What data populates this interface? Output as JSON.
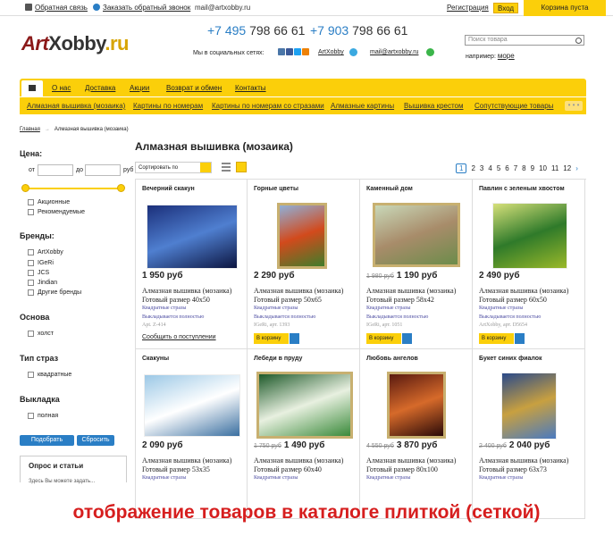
{
  "topbar": {
    "feedback": "Обратная связь",
    "callback": "Заказать обратный звонок",
    "email": "mail@artxobby.ru",
    "register": "Регистрация",
    "login": "Вход",
    "cart": "Корзина пуста"
  },
  "header": {
    "logo_art": "Art",
    "logo_xobby": "Xobby",
    "logo_ru": ".ru",
    "phone1_code": "+7 495",
    "phone1_num": "798 66 61",
    "phone2_code": "+7 903",
    "phone2_num": "798 66 61",
    "social_label": "Мы в социальных сетях:",
    "skype": "ArtXobby",
    "mail": "mail@artxobby.ru",
    "search_placeholder": "Поиск товара",
    "example_label": "например:",
    "example_value": "море"
  },
  "nav_main": [
    "О нас",
    "Доставка",
    "Акции",
    "Возврат и обмен",
    "Контакты"
  ],
  "nav_cat": [
    "Алмазная вышивка (мозаика)",
    "Картины по номерам",
    "Картины по номерам со стразами",
    "Алмазные картины",
    "Вышивка крестом",
    "Сопутствующие товары"
  ],
  "nav_more": "• • •",
  "breadcrumb": {
    "home": "Главная",
    "arrow": "→",
    "current": "Алмазная вышивка (мозаика)"
  },
  "page_title": "Алмазная вышивка (мозаика)",
  "sidebar": {
    "price": "Цена:",
    "from": "от",
    "to": "до",
    "currency": "руб",
    "price_opts": [
      "Акционные",
      "Рекомендуемые"
    ],
    "brands": "Бренды:",
    "brand_opts": [
      "ArtXobby",
      "IGeRi",
      "JCS",
      "Jindian",
      "Другие бренды"
    ],
    "base": "Основа",
    "base_opts": [
      "холст"
    ],
    "stones": "Тип страз",
    "stones_opts": [
      "квадратные"
    ],
    "layout": "Выкладка",
    "layout_opts": [
      "полная"
    ],
    "btn_select": "Подобрать",
    "btn_reset": "Сбросить",
    "box_title": "Опрос и статьи",
    "box_sub": "Здесь Вы можете задать..."
  },
  "toolbar": {
    "sort": "Сортировать по"
  },
  "pager": [
    "1",
    "2",
    "3",
    "4",
    "5",
    "6",
    "7",
    "8",
    "9",
    "10",
    "11",
    "12"
  ],
  "products": [
    {
      "name": "Вечерний скакун",
      "old": "",
      "price": "1 950 руб",
      "cat": "Алмазная вышивка (мозаика)",
      "size": "Готовый размер 40х50",
      "f1": "Квадратные стразы",
      "f2": "Выкладывается полностью",
      "art": "Apt. Z-414",
      "action": "Сообщить о поступлении",
      "cart": "В корзину",
      "colors": [
        "#1b2f7a",
        "#4f7fd0",
        "#0c1540"
      ]
    },
    {
      "name": "Горные цветы",
      "old": "",
      "price": "2 290 руб",
      "cat": "Алмазная вышивка (мозаика)",
      "size": "Готовый размер 50х65",
      "f1": "Квадратные стразы",
      "f2": "Выкладывается полностью",
      "art": "IGeRi, арт. 1393",
      "action": "",
      "cart": "В корзину",
      "colors": [
        "#8fb0d8",
        "#d24a1c",
        "#3f7d2a"
      ]
    },
    {
      "name": "Каменный дом",
      "old": "1 980 руб",
      "price": "1 190 руб",
      "cat": "Алмазная вышивка (мозаика)",
      "size": "Готовый размер 58х42",
      "f1": "Квадратные стразы",
      "f2": "Выкладывается полностью",
      "art": "IGeRi, арт. 1051",
      "action": "",
      "cart": "В корзину",
      "colors": [
        "#c9d8b8",
        "#a88c6a",
        "#6c8c4a"
      ]
    },
    {
      "name": "Павлин с зеленым хвостом",
      "old": "",
      "price": "2 490 руб",
      "cat": "Алмазная вышивка (мозаика)",
      "size": "Готовый размер 60х50",
      "f1": "Квадратные стразы",
      "f2": "Выкладывается полностью",
      "art": "ArtXobby, арт. D5654",
      "action": "",
      "cart": "В корзину",
      "colors": [
        "#d6e07a",
        "#2f7a2a",
        "#9ab82a"
      ]
    },
    {
      "name": "Скакуны",
      "old": "",
      "price": "2 090 руб",
      "cat": "Алмазная вышивка (мозаика)",
      "size": "Готовый размер 53х35",
      "f1": "Квадратные стразы",
      "f2": "",
      "art": "",
      "action": "",
      "cart": "",
      "colors": [
        "#9cc8e6",
        "#ffffff",
        "#3a6fa0"
      ]
    },
    {
      "name": "Лебеди в пруду",
      "old": "1 750 руб",
      "price": "1 490 руб",
      "cat": "Алмазная вышивка (мозаика)",
      "size": "Готовый размер 60х40",
      "f1": "Квадратные стразы",
      "f2": "",
      "art": "",
      "action": "",
      "cart": "",
      "colors": [
        "#1e5a2a",
        "#e8f0e0",
        "#3a8a3a"
      ]
    },
    {
      "name": "Любовь ангелов",
      "old": "4 550 руб",
      "price": "3 870 руб",
      "cat": "Алмазная вышивка (мозаика)",
      "size": "Готовый размер 80х100",
      "f1": "Квадратные стразы",
      "f2": "",
      "art": "",
      "action": "",
      "cart": "",
      "colors": [
        "#5a1a10",
        "#d66a2a",
        "#2a0a08"
      ]
    },
    {
      "name": "Букет синих фиалок",
      "old": "2 400 руб",
      "price": "2 040 руб",
      "cat": "Алмазная вышивка (мозаика)",
      "size": "Готовый размер 63х73",
      "f1": "Квадратные стразы",
      "f2": "",
      "art": "",
      "action": "",
      "cart": "",
      "colors": [
        "#2a4a8a",
        "#c8a040",
        "#4a7ac0"
      ]
    }
  ],
  "caption": "отображение товаров в каталоге плиткой (сеткой)"
}
